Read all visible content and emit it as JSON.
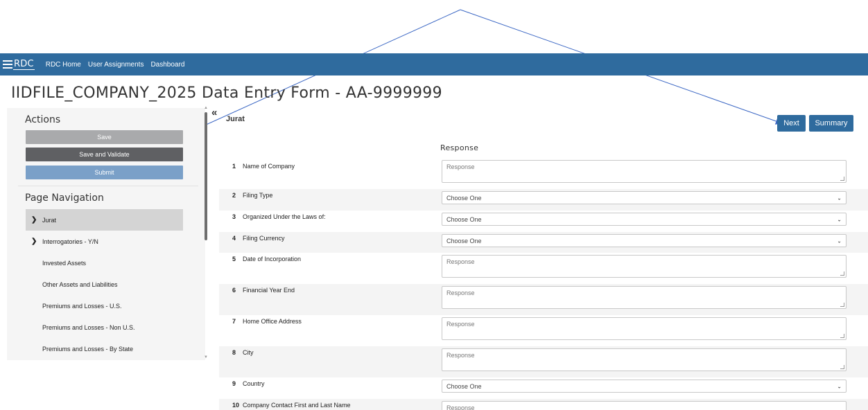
{
  "brand": {
    "logo_text": "RDC"
  },
  "nav": {
    "links": [
      "RDC Home",
      "User Assignments",
      "Dashboard"
    ]
  },
  "page": {
    "title": "IIDFILE_COMPANY_2025 Data Entry Form - AA-9999999"
  },
  "sidebar": {
    "actions_heading": "Actions",
    "actions": {
      "save": "Save",
      "save_validate": "Save and Validate",
      "submit": "Submit"
    },
    "page_nav_heading": "Page Navigation",
    "items": [
      {
        "label": "Jurat"
      },
      {
        "label": "Interrogatories - Y/N"
      },
      {
        "label": "Invested Assets"
      },
      {
        "label": "Other Assets and Liabilities"
      },
      {
        "label": "Premiums and Losses - U.S."
      },
      {
        "label": "Premiums and Losses - Non U.S."
      },
      {
        "label": "Premiums and Losses - By State"
      }
    ],
    "collapse_glyph": "«"
  },
  "main": {
    "section_title": "Jurat",
    "next_label": "Next",
    "summary_label": "Summary",
    "response_header": "Response",
    "rows": [
      {
        "num": "1",
        "label": "Name of Company",
        "value": "Response"
      },
      {
        "num": "2",
        "label": "Filing Type",
        "value": "Choose One"
      },
      {
        "num": "3",
        "label": "Organized Under the Laws of:",
        "value": "Choose One"
      },
      {
        "num": "4",
        "label": "Filing Currency",
        "value": "Choose One"
      },
      {
        "num": "5",
        "label": "Date of Incorporation",
        "value": "Response"
      },
      {
        "num": "6",
        "label": "Financial Year End",
        "value": "Response"
      },
      {
        "num": "7",
        "label": "Home Office Address",
        "value": "Response"
      },
      {
        "num": "8",
        "label": "City",
        "value": "Response"
      },
      {
        "num": "9",
        "label": "Country",
        "value": "Choose One"
      },
      {
        "num": "10",
        "label": "Company Contact First and Last Name",
        "value": "Response"
      }
    ]
  },
  "colors": {
    "brand_blue": "#2f6b9e",
    "submit_blue": "#7aa0c8",
    "save_gray": "#a9aaac",
    "validate_gray": "#5f6063"
  },
  "icons": [
    "chevron-right-icon",
    "double-chevron-left-icon",
    "dropdown-caret-icon",
    "scroll-up-icon",
    "scroll-down-icon"
  ]
}
